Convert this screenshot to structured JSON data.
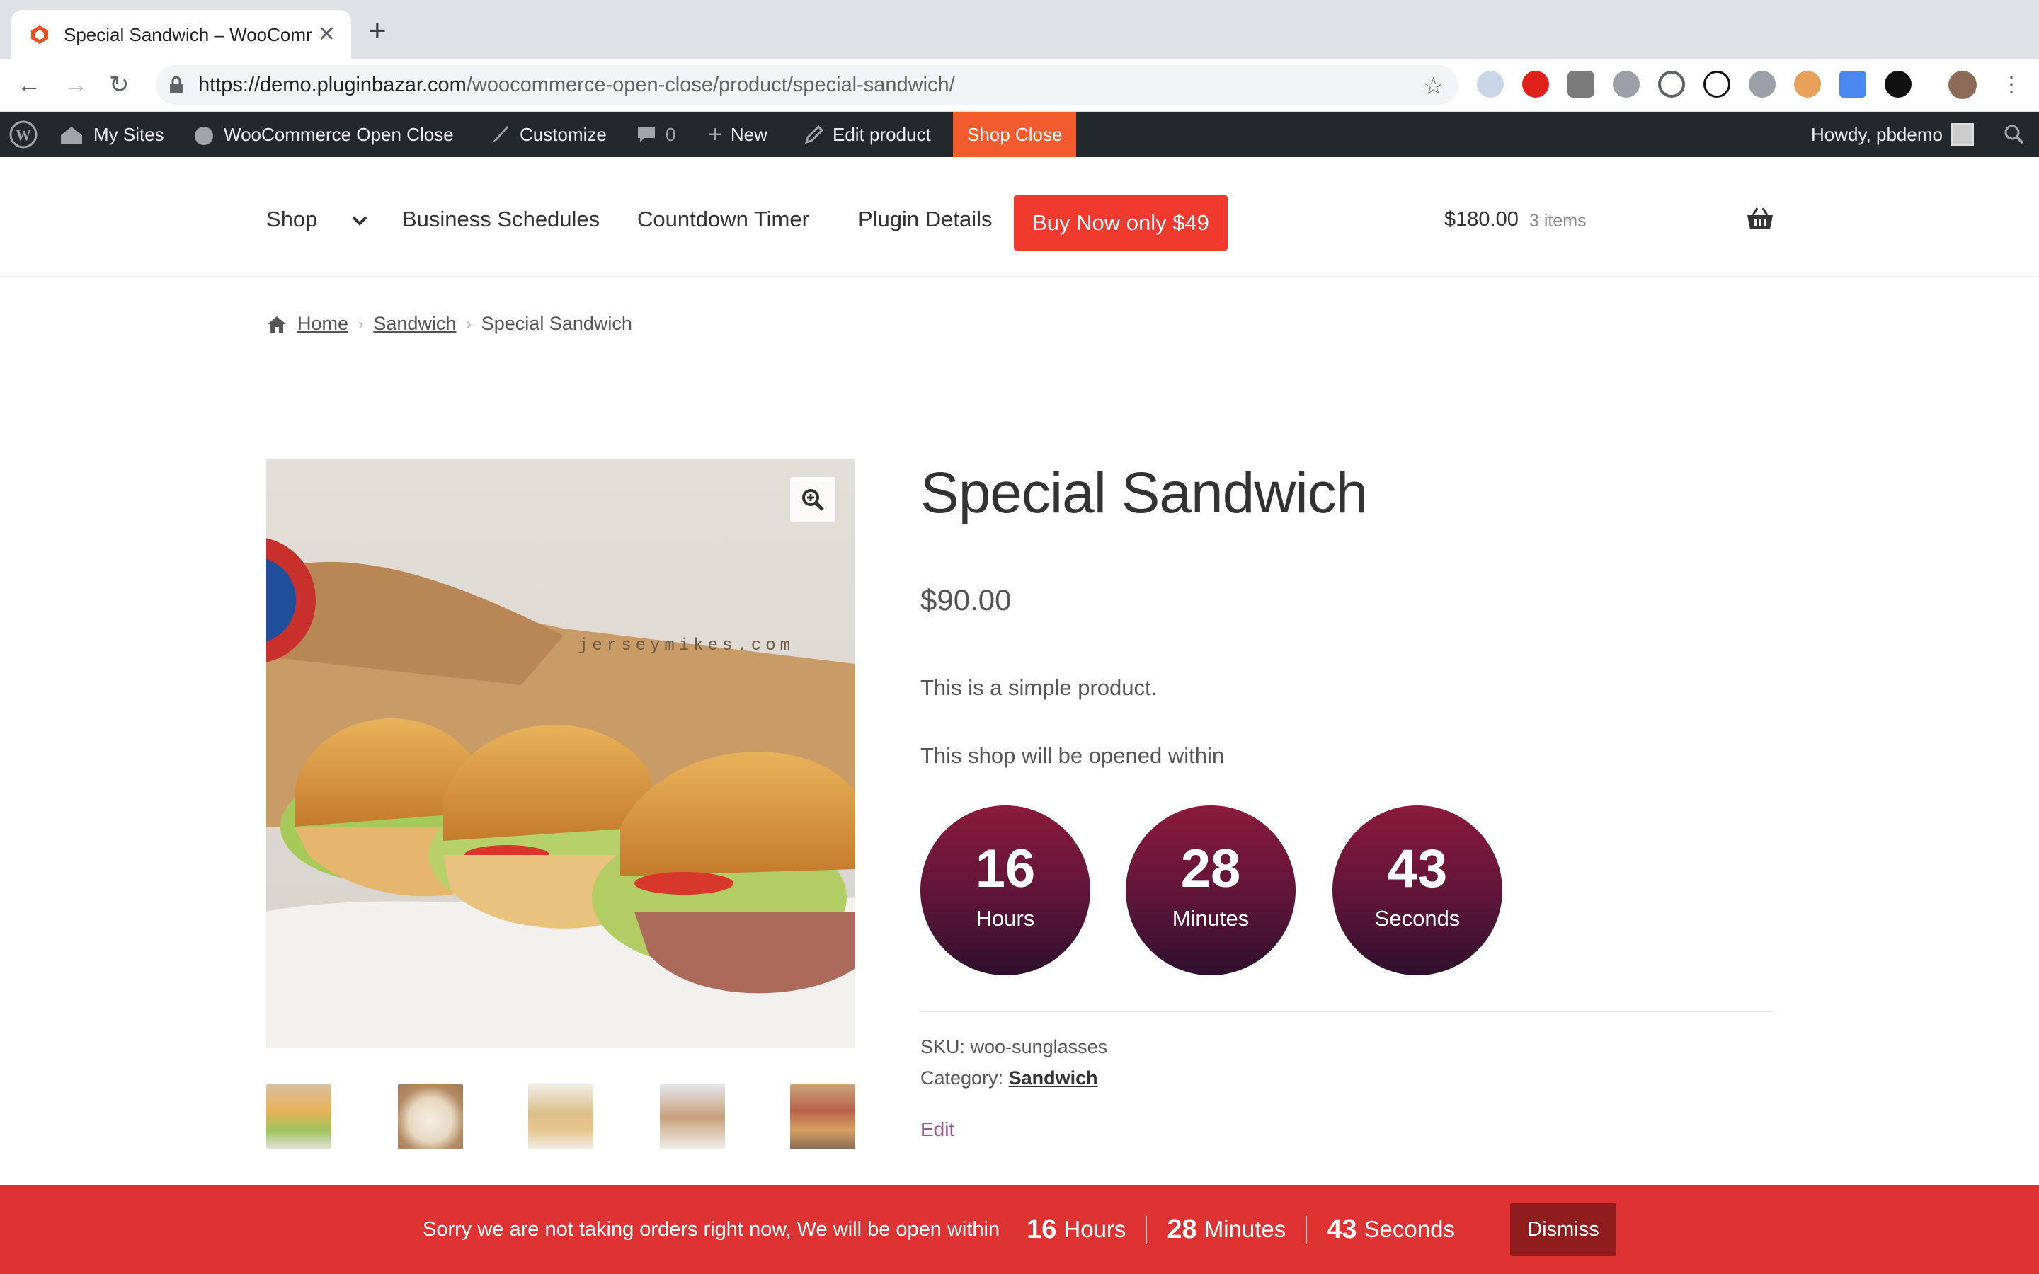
{
  "browser": {
    "tab_title": "Special Sandwich – WooComm",
    "url_host": "https://demo.pluginbazar.com",
    "url_path": "/woocommerce-open-close/product/special-sandwich/",
    "extension_icons": [
      "account-icon",
      "adblock-icon",
      "shield-icon",
      "v-icon",
      "at-icon",
      "d-icon",
      "refresh-icon",
      "wp-icon",
      "translate-icon",
      "camera-icon"
    ]
  },
  "adminbar": {
    "my_sites": "My Sites",
    "site_name": "WooCommerce Open Close",
    "customize": "Customize",
    "comments": "0",
    "new": "New",
    "edit_product": "Edit product",
    "shop_close": "Shop Close",
    "howdy": "Howdy, pbdemo"
  },
  "header": {
    "nav": [
      "Shop",
      "Business Schedules",
      "Countdown Timer",
      "Plugin Details"
    ],
    "buy_button": "Buy Now only $49",
    "cart_total": "$180.00",
    "cart_count": "3 items"
  },
  "breadcrumb": {
    "home": "Home",
    "category": "Sandwich",
    "current": "Special Sandwich"
  },
  "product": {
    "image_watermark": "jerseymikes.com",
    "title": "Special Sandwich",
    "price": "$90.00",
    "description": "This is a simple product.",
    "countdown_label": "This shop will be opened within",
    "countdown": {
      "hours": "16",
      "hours_label": "Hours",
      "minutes": "28",
      "minutes_label": "Minutes",
      "seconds": "43",
      "seconds_label": "Seconds"
    },
    "sku_label": "SKU:",
    "sku": "woo-sunglasses",
    "category_label": "Category:",
    "category": "Sandwich",
    "edit": "Edit"
  },
  "notice": {
    "text": "Sorry we are not taking orders right now, We will be open within",
    "hours": "16",
    "hours_label": "Hours",
    "minutes": "28",
    "minutes_label": "Minutes",
    "seconds": "43",
    "seconds_label": "Seconds",
    "dismiss": "Dismiss"
  },
  "colors": {
    "accent": "#ef3a2d",
    "admin_bar": "#23282d",
    "shop_close": "#f15b2e",
    "countdown_circle": "#6b1538",
    "notice_bg": "#dd3333"
  }
}
